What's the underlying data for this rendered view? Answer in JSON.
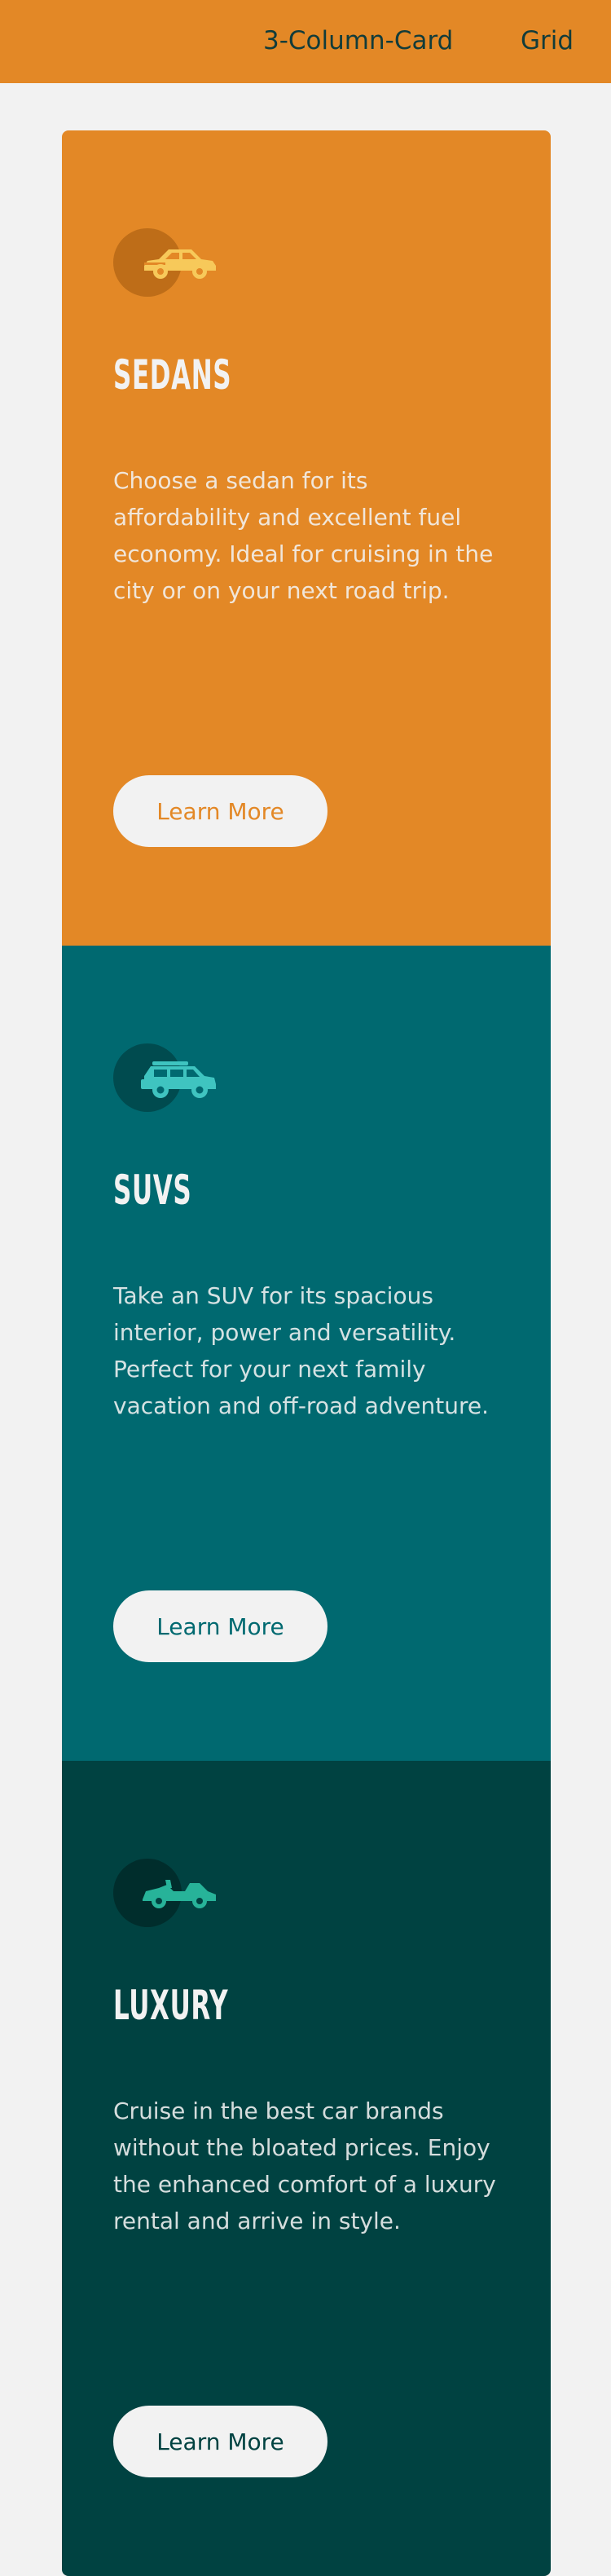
{
  "nav": {
    "links": [
      "3-Column-Card",
      "Grid"
    ],
    "text_color": "#123c3a",
    "background": "#e38826"
  },
  "cards": [
    {
      "title": "SEDANS",
      "text": "Choose a sedan for its affordability and excellent fuel economy. Ideal for cruising in the city or on your next road trip.",
      "button_label": "Learn More",
      "icon": "sedan-car-icon",
      "background": "#e38826",
      "button_text_color": "#e38826"
    },
    {
      "title": "SUVS",
      "text": "Take an SUV for its spacious interior, power and versatility. Perfect for your next family vacation and off-road adventure.",
      "button_label": "Learn More",
      "icon": "suv-car-icon",
      "background": "#006970",
      "button_text_color": "#006970"
    },
    {
      "title": "LUXURY",
      "text": "Cruise in the best car brands without the bloated prices. Enjoy the enhanced comfort of a luxury rental and arrive in style.",
      "button_label": "Learn More",
      "icon": "luxury-car-icon",
      "background": "#004241",
      "button_text_color": "#004241"
    }
  ]
}
